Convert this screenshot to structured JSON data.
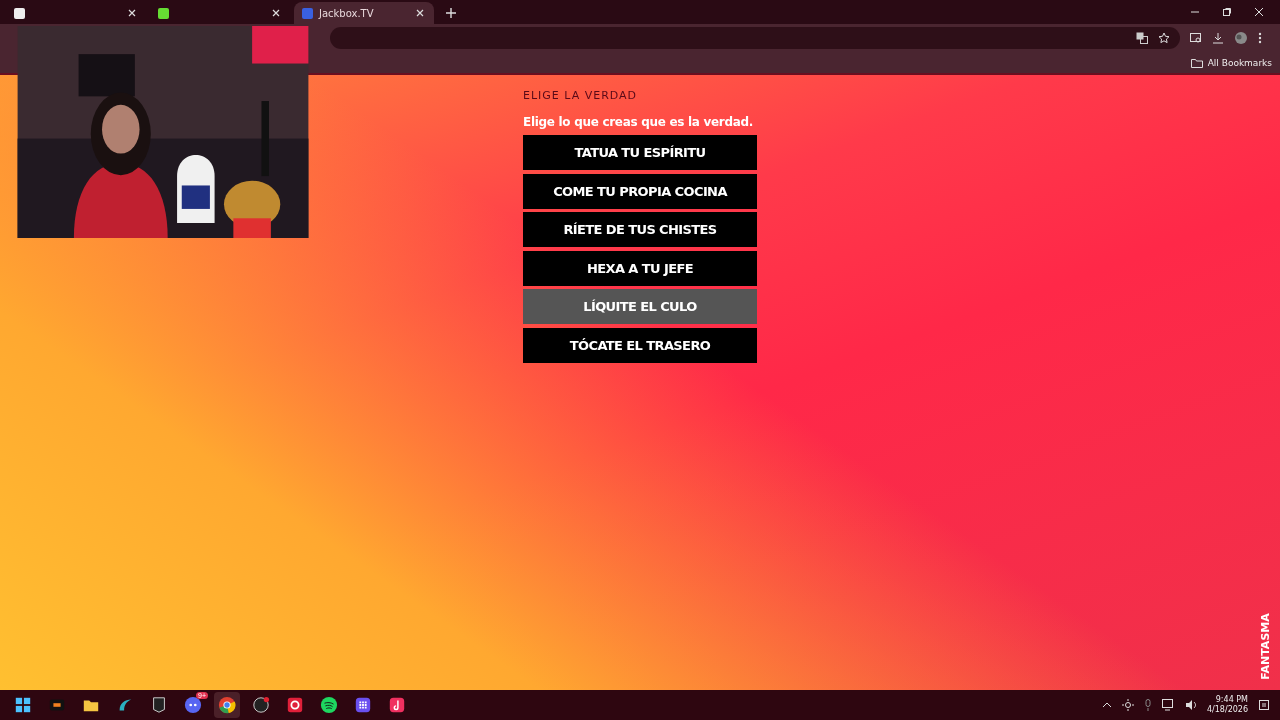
{
  "browser": {
    "tabs": [
      {
        "selected": false
      },
      {
        "selected": false
      },
      {
        "title": "Jackbox.TV",
        "selected": true
      }
    ],
    "bookmarks": [
      "All Bookmarks"
    ]
  },
  "prompt": {
    "heading": "ELIGE LA VERDAD",
    "instruction": "Elige lo que creas que es la verdad.",
    "choices": [
      {
        "label": "TATUA TU ESPÍRITU",
        "selected": false
      },
      {
        "label": "COME TU PROPIA COCINA",
        "selected": false
      },
      {
        "label": "RÍETE DE TUS CHISTES",
        "selected": false
      },
      {
        "label": "HEXA A TU JEFE",
        "selected": false
      },
      {
        "label": "LÍQUITE EL CULO",
        "selected": true
      },
      {
        "label": "TÓCATE EL TRASERO",
        "selected": false
      }
    ]
  },
  "player_name": "FANTASMA",
  "taskbar": {
    "apps": [
      {
        "kind": "start",
        "selected": false
      },
      {
        "kind": "ryzen",
        "selected": false
      },
      {
        "kind": "folder",
        "selected": false
      },
      {
        "kind": "wave",
        "selected": false
      },
      {
        "kind": "epic",
        "selected": false
      },
      {
        "kind": "discord",
        "badge": "9+",
        "selected": false
      },
      {
        "kind": "chrome",
        "selected": true
      },
      {
        "kind": "obs",
        "selected": false
      },
      {
        "kind": "record",
        "selected": false
      },
      {
        "kind": "spotify",
        "selected": false
      },
      {
        "kind": "grid",
        "selected": false
      },
      {
        "kind": "tiktok",
        "selected": false
      }
    ],
    "time": "9:44 PM",
    "date": "4/18/2026"
  }
}
